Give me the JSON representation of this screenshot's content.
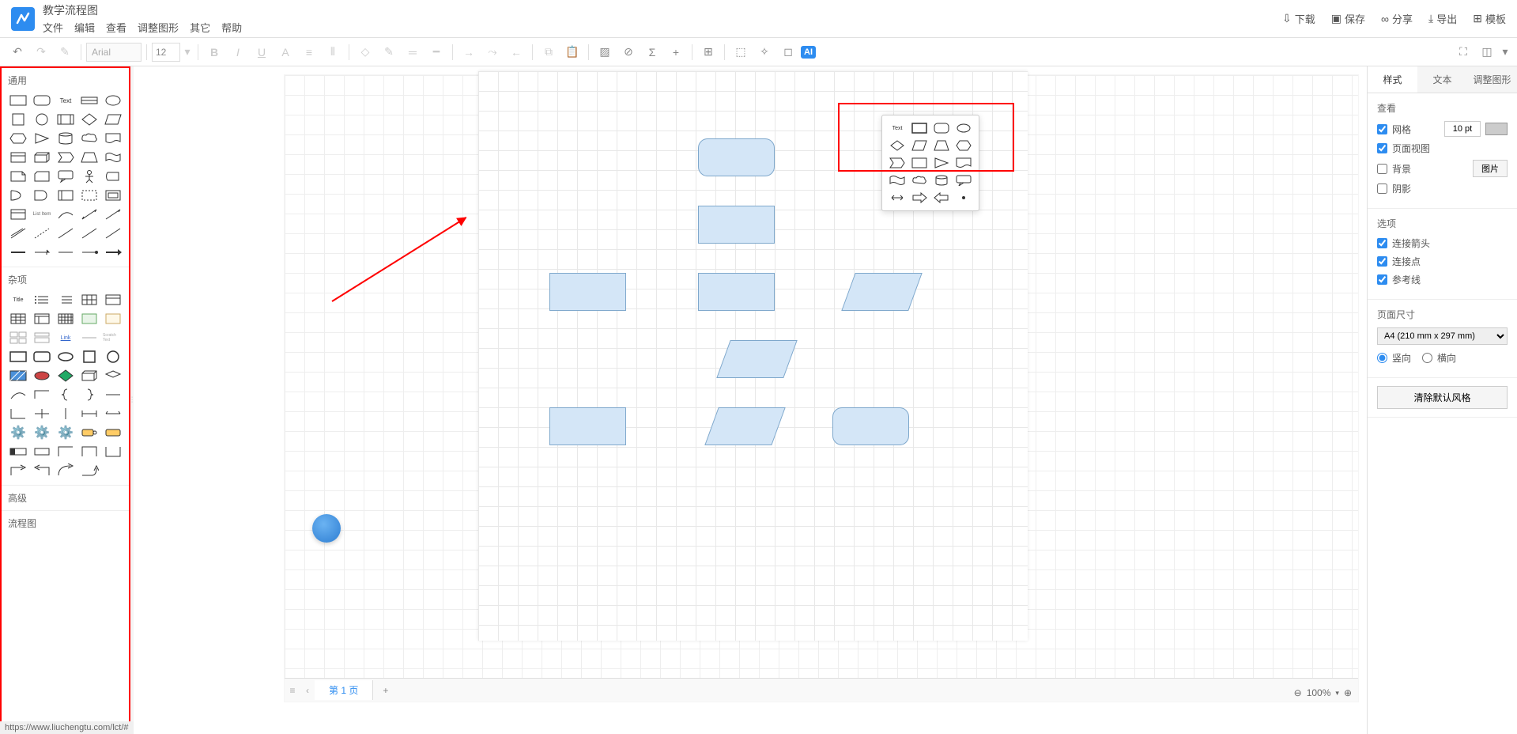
{
  "header": {
    "title": "教学流程图",
    "menu": [
      "文件",
      "编辑",
      "查看",
      "调整图形",
      "其它",
      "帮助"
    ],
    "actions": {
      "download": "下载",
      "save": "保存",
      "share": "分享",
      "export": "导出",
      "templates": "模板"
    }
  },
  "toolbar": {
    "font": "Arial",
    "size": "12",
    "ai": "AI"
  },
  "sidebar": {
    "sec_general": "通用",
    "text_label": "Text",
    "sec_misc": "杂项",
    "title_label": "Title",
    "listitem_label": "List Item",
    "link_label": "Link",
    "sec_advanced": "高级",
    "sec_flowchart": "流程图"
  },
  "popup": {
    "text_label": "Text"
  },
  "right": {
    "tabs": {
      "style": "样式",
      "text": "文本",
      "adjust": "调整图形"
    },
    "view_sec": "查看",
    "grid": "网格",
    "grid_val": "10 pt",
    "page_view": "页面视图",
    "background": "背景",
    "image_btn": "图片",
    "shadow": "阴影",
    "options_sec": "选项",
    "conn_arrow": "连接箭头",
    "conn_point": "连接点",
    "guides": "参考线",
    "pagesize_sec": "页面尺寸",
    "page_size": "A4 (210 mm x 297 mm)",
    "portrait": "竖向",
    "landscape": "横向",
    "clear": "清除默认风格"
  },
  "bottom": {
    "page1": "第 1 页",
    "add": "+",
    "zoom": "100%"
  },
  "status": {
    "url": "https://www.liuchengtu.com/lct/#"
  }
}
